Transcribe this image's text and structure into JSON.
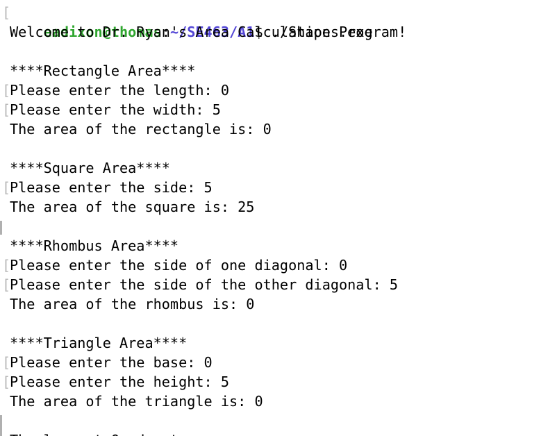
{
  "prompt": {
    "user_host": "eadixon@thomas",
    "separator": ":",
    "path": "~/SE463/A1",
    "symbol": "$ ",
    "command": "./Shapes.exe"
  },
  "bracket_glyph": "[",
  "lines": [
    {
      "text": "Welcome to Dr. Ryan's Area Calculation Program!",
      "bracket": false
    },
    {
      "text": "",
      "bracket": false
    },
    {
      "text": "****Rectangle Area****",
      "bracket": false
    },
    {
      "text": "Please enter the length: 0",
      "bracket": true
    },
    {
      "text": "Please enter the width: 5",
      "bracket": true
    },
    {
      "text": "The area of the rectangle is: 0",
      "bracket": false
    },
    {
      "text": "",
      "bracket": false
    },
    {
      "text": "****Square Area****",
      "bracket": false
    },
    {
      "text": "Please enter the side: 5",
      "bracket": true
    },
    {
      "text": "The area of the square is: 25",
      "bracket": false
    },
    {
      "text": "",
      "bracket": false
    },
    {
      "text": "****Rhombus Area****",
      "bracket": false
    },
    {
      "text": "Please enter the side of one diagonal: 0",
      "bracket": true
    },
    {
      "text": "Please enter the side of the other diagonal: 5",
      "bracket": true
    },
    {
      "text": "The area of the rhombus is: 0",
      "bracket": false
    },
    {
      "text": "",
      "bracket": false
    },
    {
      "text": "****Triangle Area****",
      "bracket": false
    },
    {
      "text": "Please enter the base: 0",
      "bracket": true
    },
    {
      "text": "Please enter the height: 5",
      "bracket": true
    },
    {
      "text": "The area of the triangle is: 0",
      "bracket": false
    },
    {
      "text": "",
      "bracket": false
    },
    {
      "text": "The largest Quadrant area...",
      "bracket": false
    }
  ],
  "colors": {
    "user_host": "#2fa62f",
    "path": "#5346d6",
    "text": "#000000",
    "bracket": "#b8b8b8"
  }
}
